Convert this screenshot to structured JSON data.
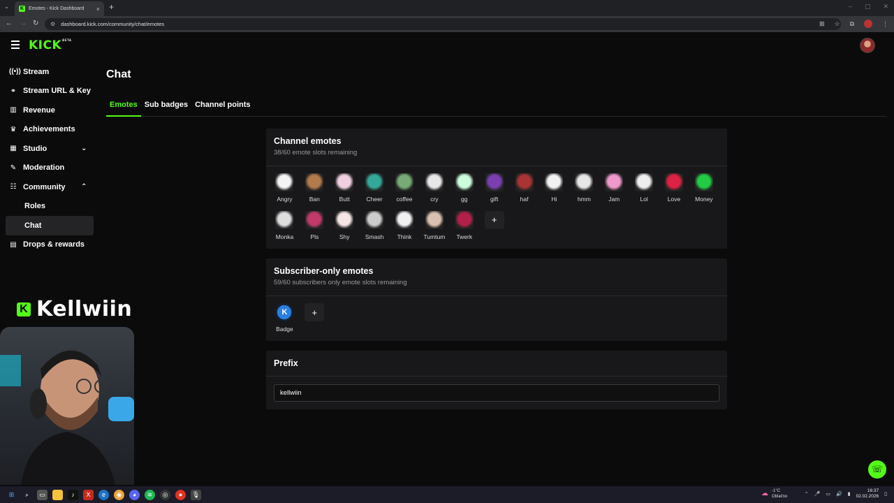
{
  "browser": {
    "tab_title": "Emotes - Kick Dashboard",
    "url": "dashboard.kick.com/community/chat/emotes"
  },
  "header": {
    "logo": "KICK",
    "logo_tag": "BETA"
  },
  "sidebar": {
    "items": [
      {
        "label": "Stream",
        "icon": "broadcast-icon"
      },
      {
        "label": "Stream URL & Key",
        "icon": "link-icon"
      },
      {
        "label": "Revenue",
        "icon": "chart-icon"
      },
      {
        "label": "Achievements",
        "icon": "trophy-icon"
      },
      {
        "label": "Studio",
        "icon": "studio-icon"
      },
      {
        "label": "Moderation",
        "icon": "wrench-icon"
      },
      {
        "label": "Community",
        "icon": "community-icon"
      },
      {
        "label": "Roles"
      },
      {
        "label": "Chat"
      },
      {
        "label": "Drops & rewards",
        "icon": "gift-icon"
      }
    ]
  },
  "overlay": {
    "streamer_name": "Kellwiin"
  },
  "page": {
    "title": "Chat",
    "tabs": [
      "Emotes",
      "Sub badges",
      "Channel points"
    ]
  },
  "channel_emotes": {
    "title": "Channel emotes",
    "subtitle": "38/60 emote slots remaining",
    "emotes": [
      "Angry",
      "Ban",
      "Butt",
      "Cheer",
      "coffee",
      "cry",
      "gg",
      "gift",
      "haf",
      "Hi",
      "hmm",
      "Jam",
      "Lol",
      "Love",
      "Money",
      "Monka",
      "Pls",
      "Shy",
      "Smash",
      "Think",
      "Tumtum",
      "Twerk"
    ]
  },
  "sub_emotes": {
    "title": "Subscriber-only emotes",
    "subtitle": "59/60 subscribers only emote slots remaining",
    "emotes": [
      "Badge"
    ]
  },
  "prefix": {
    "title": "Prefix",
    "value": "kellwiin"
  },
  "taskbar": {
    "weather_temp": "-1°C",
    "weather_desc": "Oblačno",
    "time": "16:37",
    "date": "02.02.2026"
  },
  "colors": {
    "accent": "#53fc18",
    "background": "#0b0b0c",
    "card": "#18181a"
  }
}
